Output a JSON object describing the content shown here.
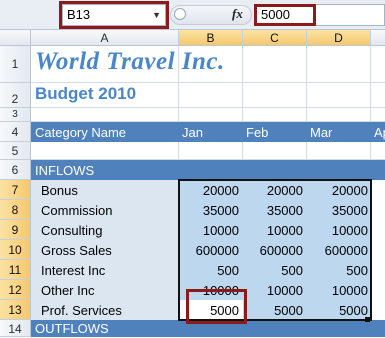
{
  "formula_bar": {
    "name_box": "B13",
    "fx_label": "fx",
    "formula_value": "5000"
  },
  "columns": [
    "A",
    "B",
    "C",
    "D"
  ],
  "rows": [
    "1",
    "2",
    "3",
    "4",
    "5",
    "6",
    "7",
    "8",
    "9",
    "10",
    "11",
    "12",
    "13",
    "14"
  ],
  "sheet": {
    "title": "World Travel Inc.",
    "subtitle": "Budget 2010",
    "header_row": {
      "category": "Category Name",
      "jan": "Jan",
      "feb": "Feb",
      "mar": "Mar",
      "apr": "Ap"
    },
    "inflows_label": "INFLOWS",
    "outflows_label": "OUTFLOWS",
    "items": [
      {
        "name": "Bonus",
        "jan": "20000",
        "feb": "20000",
        "mar": "20000"
      },
      {
        "name": "Commission",
        "jan": "35000",
        "feb": "35000",
        "mar": "35000"
      },
      {
        "name": "Consulting",
        "jan": "10000",
        "feb": "10000",
        "mar": "10000"
      },
      {
        "name": "Gross Sales",
        "jan": "600000",
        "feb": "600000",
        "mar": "600000"
      },
      {
        "name": "Interest Inc",
        "jan": "500",
        "feb": "500",
        "mar": "500"
      },
      {
        "name": "Other Inc",
        "jan": "10000",
        "feb": "10000",
        "mar": "10000"
      },
      {
        "name": "Prof. Services",
        "jan": "5000",
        "feb": "5000",
        "mar": "5000"
      }
    ]
  },
  "colors": {
    "header_band": "#4f81bd",
    "title_text": "#4a86c8",
    "selected_range": "#bdd7ee",
    "highlight_box": "#8b1a1a"
  }
}
